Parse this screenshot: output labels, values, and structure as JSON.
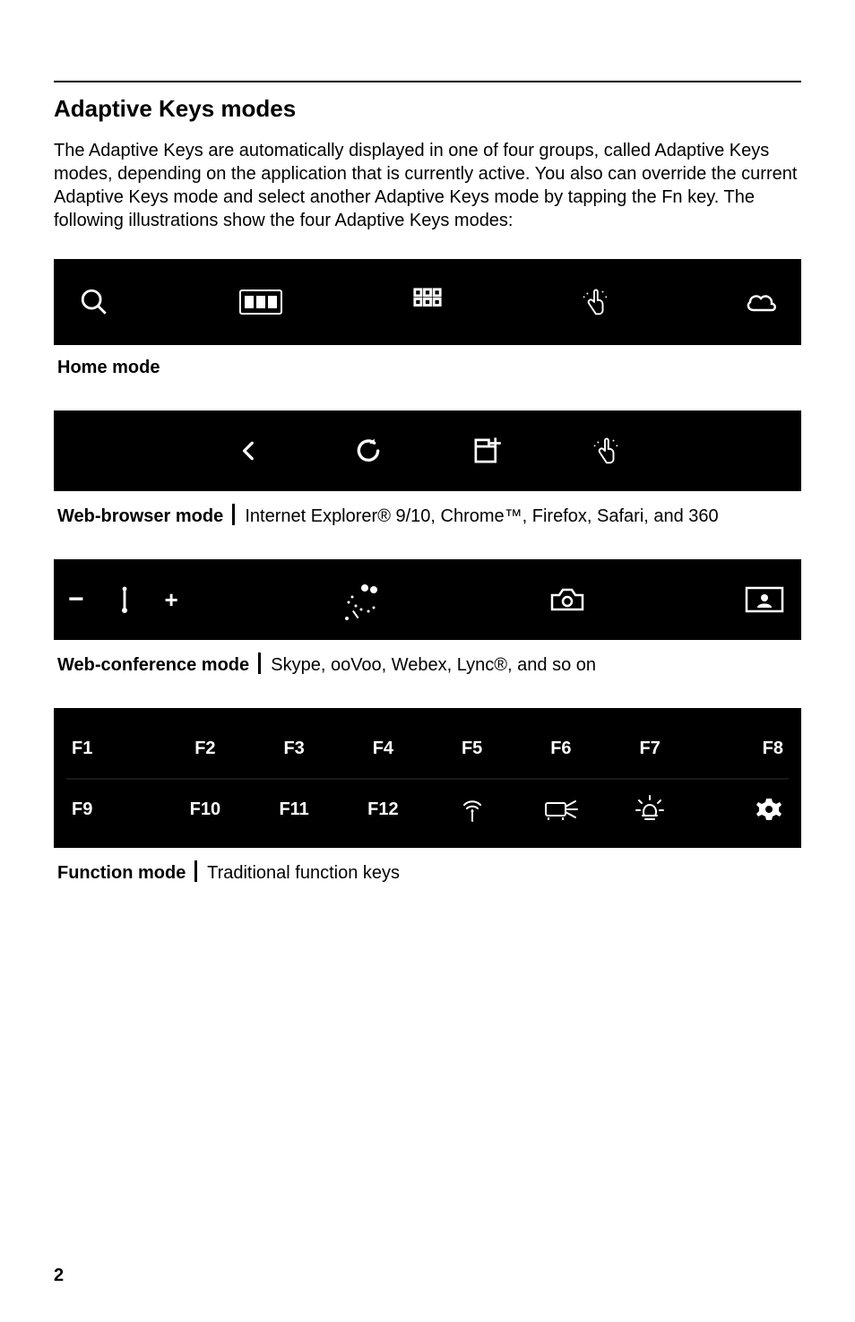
{
  "page_number": "2",
  "section_title": "Adaptive Keys modes",
  "intro_text": "The Adaptive Keys are automatically displayed in one of four groups, called Adaptive Keys modes, depending on the application that is currently active. You also can override the current Adaptive Keys mode and select another Adaptive Keys mode by tapping the Fn key. The following illustrations show the four Adaptive Keys modes:",
  "home_mode": {
    "label": "Home mode",
    "icons": [
      "search-icon",
      "apps-window-icon",
      "grid-icon",
      "gesture-icon",
      "cloud-icon"
    ]
  },
  "web_browser_mode": {
    "label": "Web-browser mode",
    "desc": "Internet Explorer® 9/10, Chrome™, Firefox, Safari, and 360",
    "icons": [
      "back-icon",
      "refresh-icon",
      "new-tab-icon",
      "gesture-icon"
    ]
  },
  "web_conference_mode": {
    "label": "Web-conference mode",
    "desc": "Skype, ooVoo, Webex, Lync®, and so on",
    "left_group": {
      "minus": "−",
      "plus": "+"
    },
    "icons": [
      "mic-minus-plus",
      "background-blur-icon",
      "camera-icon",
      "share-screen-icon"
    ]
  },
  "function_mode": {
    "label": "Function mode",
    "desc": "Traditional function keys",
    "row1": [
      "F1",
      "F2",
      "F3",
      "F4",
      "F5",
      "F6",
      "F7",
      "F8"
    ],
    "row2_keys": [
      "F9",
      "F10",
      "F11",
      "F12"
    ],
    "row2_icons": [
      "wireless-icon",
      "projector-icon",
      "brightness-icon",
      "settings-gear-icon"
    ]
  }
}
